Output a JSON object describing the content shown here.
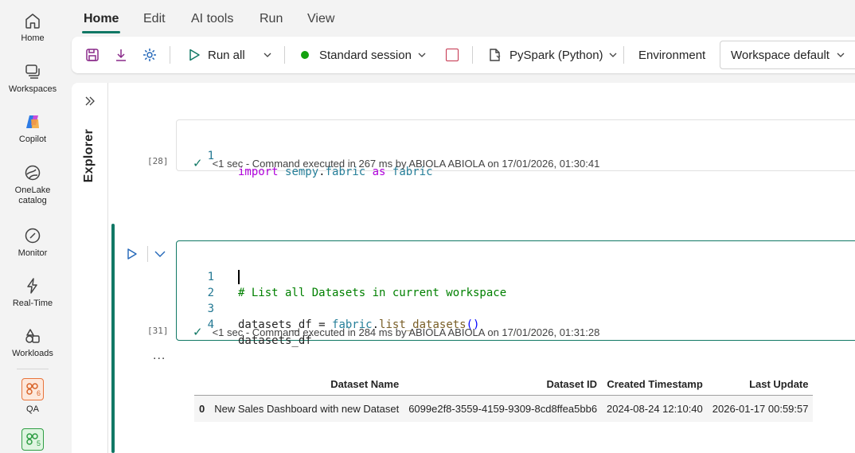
{
  "rail": {
    "items": [
      {
        "label": "Home",
        "icon": "home-icon"
      },
      {
        "label": "Workspaces",
        "icon": "workspaces-icon"
      },
      {
        "label": "Copilot",
        "icon": "copilot-icon"
      },
      {
        "label": "OneLake catalog",
        "icon": "onelake-icon"
      },
      {
        "label": "Monitor",
        "icon": "monitor-icon"
      },
      {
        "label": "Real-Time",
        "icon": "lightning-icon"
      },
      {
        "label": "Workloads",
        "icon": "workloads-icon"
      }
    ],
    "workspaces": [
      {
        "label": "QA",
        "badge": "6",
        "color": "#e8743b"
      },
      {
        "label": "",
        "badge": "5",
        "color": "#2f9e44"
      }
    ]
  },
  "tabs": [
    "Home",
    "Edit",
    "AI tools",
    "Run",
    "View"
  ],
  "active_tab": "Home",
  "toolbar": {
    "run_all": "Run all",
    "session": "Standard session",
    "language": "PySpark (Python)",
    "environment_label": "Environment",
    "environment_value": "Workspace default"
  },
  "explorer": {
    "label": "Explorer"
  },
  "cells": [
    {
      "exec_count": "[28]",
      "lines": [
        {
          "n": "1",
          "tokens": [
            {
              "t": "import",
              "c": "kw"
            },
            {
              "t": " ",
              "c": ""
            },
            {
              "t": "sempy",
              "c": "mod"
            },
            {
              "t": ".",
              "c": ""
            },
            {
              "t": "fabric",
              "c": "mod"
            },
            {
              "t": " ",
              "c": ""
            },
            {
              "t": "as",
              "c": "kw"
            },
            {
              "t": " ",
              "c": ""
            },
            {
              "t": "fabric",
              "c": "mod"
            }
          ]
        }
      ],
      "status": "<1 sec - Command executed in 267 ms by ABIOLA ABIOLA on 17/01/2026, 01:30:41"
    },
    {
      "exec_count": "[31]",
      "lines": [
        {
          "n": "1",
          "tokens": [
            {
              "t": "# List all Datasets in current workspace",
              "c": "cm"
            }
          ]
        },
        {
          "n": "2",
          "tokens": []
        },
        {
          "n": "3",
          "tokens": [
            {
              "t": "datasets_df",
              "c": ""
            },
            {
              "t": " = ",
              "c": ""
            },
            {
              "t": "fabric",
              "c": "mod"
            },
            {
              "t": ".",
              "c": ""
            },
            {
              "t": "list_datasets",
              "c": "fn"
            },
            {
              "t": "()",
              "c": "pl"
            }
          ]
        },
        {
          "n": "4",
          "tokens": [
            {
              "t": "datasets_df",
              "c": ""
            }
          ]
        }
      ],
      "status": "<1 sec - Command executed in 284 ms by ABIOLA ABIOLA on 17/01/2026, 01:31:28"
    }
  ],
  "output_ellipsis": "...",
  "output_table": {
    "columns": [
      "",
      "Dataset Name",
      "Dataset ID",
      "Created Timestamp",
      "Last Update"
    ],
    "rows": [
      [
        "0",
        "New Sales Dashboard with new Dataset",
        "6099e2f8-3559-4159-9309-8cd8ffea5bb6",
        "2024-08-24 12:10:40",
        "2026-01-17 00:59:57"
      ]
    ]
  }
}
